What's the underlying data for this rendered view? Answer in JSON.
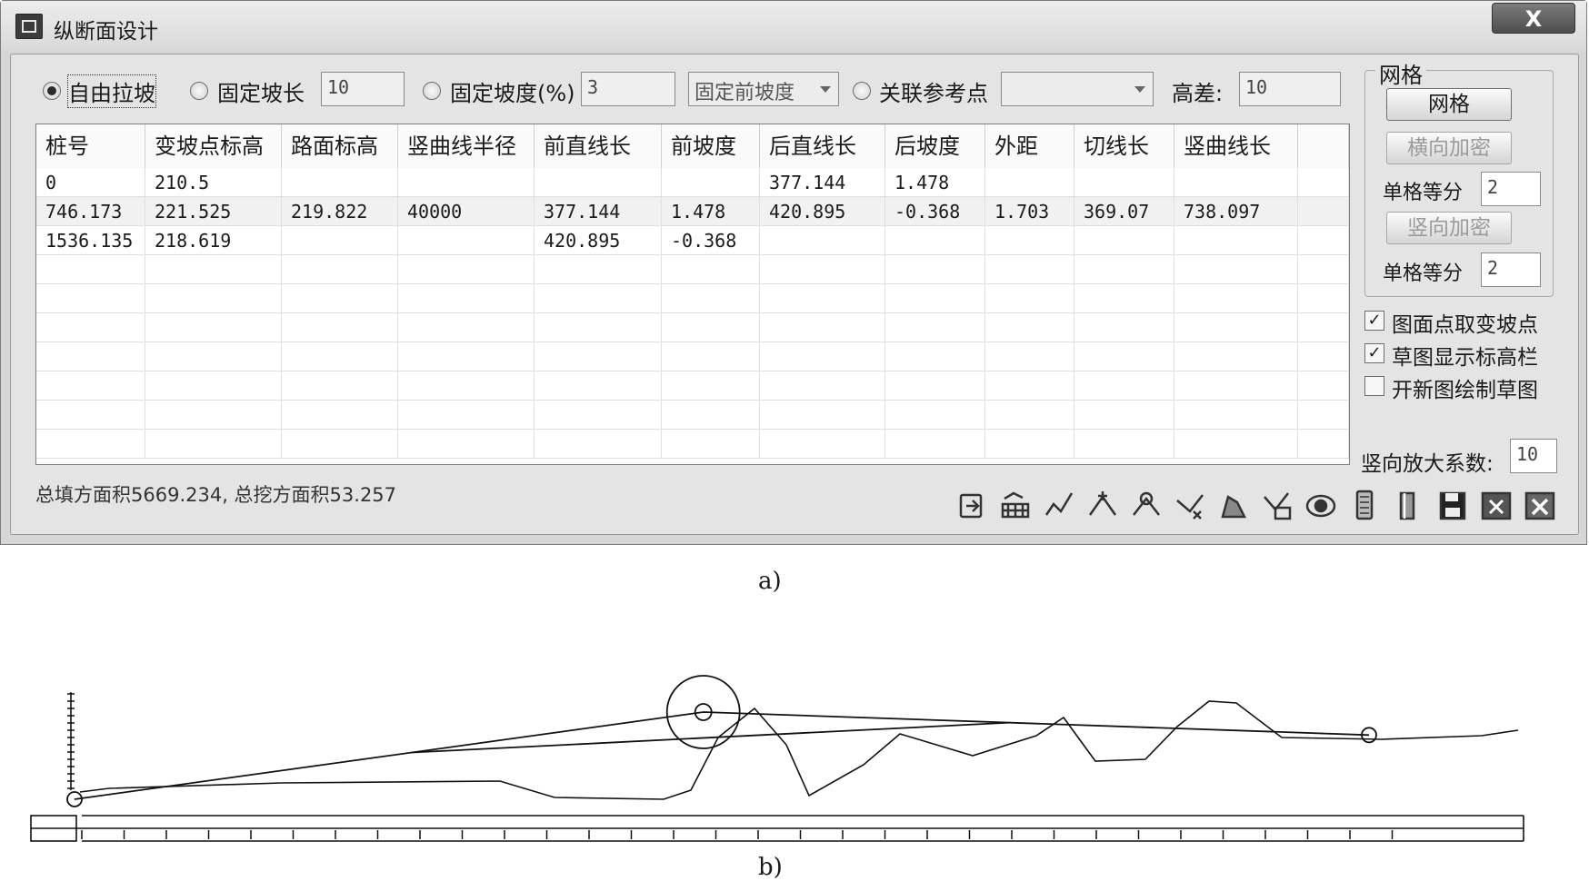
{
  "window": {
    "title": "纵断面设计",
    "close_label": "X"
  },
  "modes": {
    "free_slope": "自由拉坡",
    "fixed_length": "固定坡长",
    "fixed_length_value": "10",
    "fixed_grade": "固定坡度(%)",
    "fixed_grade_value": "3",
    "fixed_grade_combo": "固定前坡度",
    "ref_point": "关联参考点",
    "ref_point_combo": "",
    "height_diff_label": "高差:",
    "height_diff_value": "10",
    "selected": "free_slope"
  },
  "table": {
    "columns": [
      "桩号",
      "变坡点标高",
      "路面标高",
      "竖曲线半径",
      "前直线长",
      "前坡度",
      "后直线长",
      "后坡度",
      "外距",
      "切线长",
      "竖曲线长"
    ],
    "rows": [
      [
        "0",
        "210.5",
        "",
        "",
        "",
        "",
        "377.144",
        "1.478",
        "",
        "",
        ""
      ],
      [
        "746.173",
        "221.525",
        "219.822",
        "40000",
        "377.144",
        "1.478",
        "420.895",
        "-0.368",
        "1.703",
        "369.07",
        "738.097"
      ],
      [
        "1536.135",
        "218.619",
        "",
        "",
        "420.895",
        "-0.368",
        "",
        "",
        "",
        "",
        ""
      ]
    ]
  },
  "summary": "总填方面积5669.234, 总挖方面积53.257",
  "grid_panel": {
    "group_title": "网格",
    "grid_button": "网格",
    "horiz_densify_button": "横向加密",
    "unit_divide_label_1": "单格等分",
    "unit_divide_value_1": "2",
    "vert_densify_button": "竖向加密",
    "unit_divide_label_2": "单格等分",
    "unit_divide_value_2": "2"
  },
  "options": {
    "pick_point_label": "图面点取变坡点",
    "pick_point_checked": true,
    "show_elev_bar_label": "草图显示标高栏",
    "show_elev_bar_checked": true,
    "new_drawing_label": "开新图绘制草图",
    "new_drawing_checked": false,
    "vert_scale_label": "竖向放大系数:",
    "vert_scale_value": "10"
  },
  "toolbar_icons": [
    "import-icon",
    "elevation-bar-icon",
    "slope-line-icon",
    "insert-point-icon",
    "vertical-curve-icon",
    "delete-point-icon",
    "fill-cut-icon",
    "profile-table-icon",
    "view-eye-icon",
    "calculator-icon",
    "export-icon",
    "save-icon",
    "excel-icon",
    "close-icon"
  ],
  "captions": {
    "a": "a)",
    "b": "b)"
  },
  "chart_data": {
    "type": "line",
    "series": [
      {
        "points": [
          [
            0,
            210.5
          ],
          [
            746.173,
            221.525
          ],
          [
            1536.135,
            218.619
          ]
        ]
      }
    ]
  },
  "colors": {
    "window_bg": "#d6d6d6",
    "panel_bg": "#e4e4e4",
    "grid_bg": "#ffffff",
    "line": "#111111"
  }
}
